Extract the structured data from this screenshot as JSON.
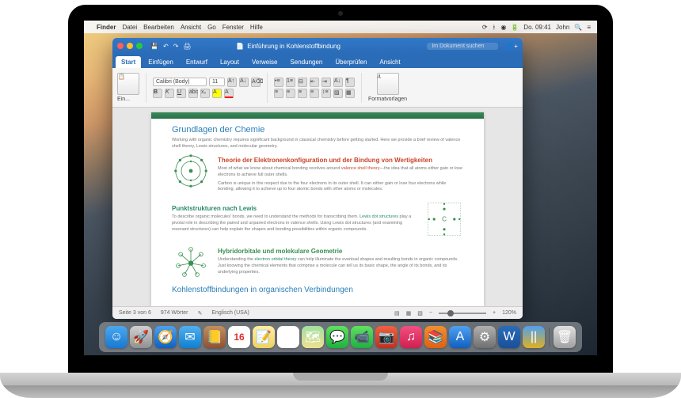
{
  "menubar": {
    "apple": "",
    "app": "Finder",
    "items": [
      "Datei",
      "Bearbeiten",
      "Ansicht",
      "Go",
      "Fenster",
      "Hilfe"
    ],
    "battery": "100%",
    "clock": "Do. 09:41",
    "user": "John"
  },
  "titlebar": {
    "doc_icon": "📄",
    "title": "Einführung in Kohlenstoffbindung",
    "search_placeholder": "Im Dokument suchen",
    "share_icon": "👤+"
  },
  "ribbon_tabs": [
    "Start",
    "Einfügen",
    "Entwurf",
    "Layout",
    "Verweise",
    "Sendungen",
    "Überprüfen",
    "Ansicht"
  ],
  "ribbon": {
    "paste_label": "Ein...",
    "font_name": "Calibri (Body)",
    "font_size": "11",
    "bold": "B",
    "italic": "K",
    "underline": "U",
    "styles_label": "Formatvorlagen"
  },
  "document": {
    "h1": "Grundlagen der Chemie",
    "intro": "Working with organic chemistry requires significant background in classical chemistry before getting started. Here we provide a brief review of valence shell theory, Lewis structures, and molecular geometry.",
    "s1_title": "Theorie der Elektronenkonfiguration und der Bindung von Wertigkeiten",
    "s1_p1a": "Most of what we know about chemical bonding revolves around ",
    "s1_p1_em": "valence shell theory",
    "s1_p1b": "—the idea that all atoms either gain or lose electrons to achieve full outer shells.",
    "s1_p2": "Carbon is unique in this respect due to the four electrons in its outer shell. It can either gain or lose four electrons while bonding, allowing it to achieve up to four atomic bonds with other atoms or molecules.",
    "s2_title": "Punktstrukturen nach Lewis",
    "s2_p1a": "To describe organic molecules' bonds, we need to understand the methods for transcribing them. ",
    "s2_p1_em": "Lewis dot structures",
    "s2_p1b": " play a pivotal role in describing the paired and unpaired electrons in valence shells. Using Lewis dot structures (and examining resonant structures) can help explain the shapes and bonding possibilities within organic compounds.",
    "s3_title": "Hybridorbitale und molekulare Geometrie",
    "s3_p1a": "Understanding the ",
    "s3_p1_em": "electron orbital theory",
    "s3_p1b": " can help illuminate the eventual shapes and resulting bonds in organic compounds. Just knowing the chemical elements that comprise a molecule can tell us its basic shape, the angle of its bonds, and its underlying properties.",
    "s4_title": "Kohlenstoffbindungen in organischen Verbindungen"
  },
  "statusbar": {
    "page": "Seite 3 von 6",
    "words": "974 Wörter",
    "lang": "Englisch (USA)",
    "zoom": "120%"
  },
  "dock_icons": [
    {
      "name": "finder-icon",
      "bg": "linear-gradient(#4aa8f0,#1a78d0)",
      "glyph": "☺"
    },
    {
      "name": "launchpad-icon",
      "bg": "linear-gradient(#d0d0d0,#909090)",
      "glyph": "🚀"
    },
    {
      "name": "safari-icon",
      "bg": "linear-gradient(#50a0f0,#1060c0)",
      "glyph": "🧭"
    },
    {
      "name": "mail-icon",
      "bg": "linear-gradient(#50b0f0,#1080d0)",
      "glyph": "✉"
    },
    {
      "name": "contacts-icon",
      "bg": "linear-gradient(#c09060,#905030)",
      "glyph": "📒"
    },
    {
      "name": "calendar-icon",
      "bg": "#fff",
      "glyph": "16"
    },
    {
      "name": "notes-icon",
      "bg": "linear-gradient(#fff0a0,#f0d060)",
      "glyph": "📝"
    },
    {
      "name": "reminders-icon",
      "bg": "#fff",
      "glyph": "☑"
    },
    {
      "name": "maps-icon",
      "bg": "linear-gradient(#a0e0a0,#f0e090)",
      "glyph": "🗺"
    },
    {
      "name": "messages-icon",
      "bg": "linear-gradient(#60e060,#20b040)",
      "glyph": "💬"
    },
    {
      "name": "facetime-icon",
      "bg": "linear-gradient(#60e060,#20b040)",
      "glyph": "📹"
    },
    {
      "name": "photobooth-icon",
      "bg": "linear-gradient(#f06040,#c03020)",
      "glyph": "📷"
    },
    {
      "name": "itunes-icon",
      "bg": "linear-gradient(#f05080,#d02050)",
      "glyph": "♫"
    },
    {
      "name": "ibooks-icon",
      "bg": "linear-gradient(#f09030,#e06010)",
      "glyph": "📚"
    },
    {
      "name": "appstore-icon",
      "bg": "linear-gradient(#50a0f0,#1060c0)",
      "glyph": "A"
    },
    {
      "name": "preferences-icon",
      "bg": "linear-gradient(#b0b0b0,#707070)",
      "glyph": "⚙"
    },
    {
      "name": "word-icon",
      "bg": "linear-gradient(#2a6cb8,#1a5098)",
      "glyph": "W"
    },
    {
      "name": "parallels-icon",
      "bg": "linear-gradient(#50a0f0,#e0b020)",
      "glyph": "||"
    },
    {
      "name": "trash-icon",
      "bg": "linear-gradient(#e0e0e0,#a0a0a0)",
      "glyph": "🗑"
    }
  ]
}
